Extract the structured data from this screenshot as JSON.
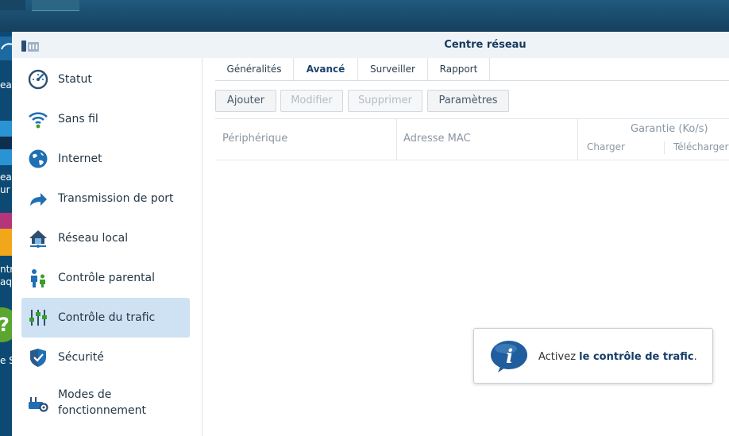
{
  "window": {
    "title": "Centre réseau"
  },
  "desktop": {
    "labels": [
      "ea",
      "ur",
      "ntr",
      "aq",
      "e S"
    ]
  },
  "sidebar": {
    "items": [
      {
        "label": "Statut",
        "icon": "gauge-icon"
      },
      {
        "label": "Sans fil",
        "icon": "wifi-icon"
      },
      {
        "label": "Internet",
        "icon": "globe-icon"
      },
      {
        "label": "Transmission de port",
        "icon": "forward-arrow-icon"
      },
      {
        "label": "Réseau local",
        "icon": "home-network-icon"
      },
      {
        "label": "Contrôle parental",
        "icon": "parent-child-icon"
      },
      {
        "label": "Contrôle du trafic",
        "icon": "sliders-icon",
        "active": true
      },
      {
        "label": "Sécurité",
        "icon": "shield-icon"
      },
      {
        "label": "Modes de\nfonctionnement",
        "label_line1": "Modes de",
        "label_line2": "fonctionnement",
        "icon": "router-gear-icon"
      }
    ]
  },
  "tabs": [
    {
      "label": "Généralités"
    },
    {
      "label": "Avancé",
      "active": true
    },
    {
      "label": "Surveiller"
    },
    {
      "label": "Rapport"
    }
  ],
  "toolbar": {
    "add": "Ajouter",
    "modify": "Modifier",
    "delete": "Supprimer",
    "settings": "Paramètres"
  },
  "grid": {
    "col_device": "Périphérique",
    "col_mac": "Adresse MAC",
    "col_guarantee": "Garantie (Ko/s)",
    "col_upload": "Charger",
    "col_download": "Télécharger"
  },
  "info": {
    "prefix": "Activez ",
    "link": "le contrôle de trafic",
    "suffix": "."
  },
  "colors": {
    "accent": "#1c4470",
    "active_bg": "#cfe2f3",
    "icon_blue": "#1f6fb5"
  }
}
